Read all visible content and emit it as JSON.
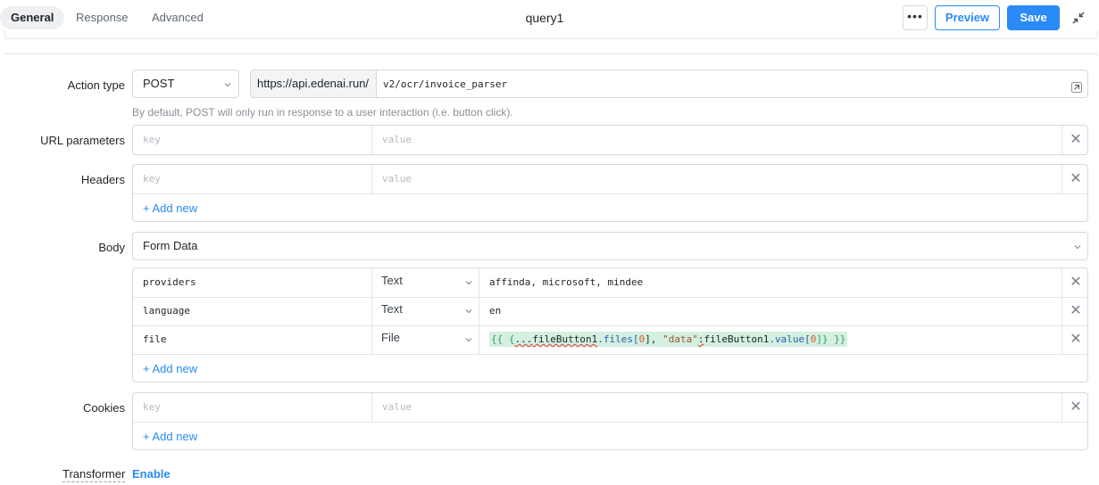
{
  "header": {
    "tabs": [
      {
        "label": "General",
        "active": true
      },
      {
        "label": "Response",
        "active": false
      },
      {
        "label": "Advanced",
        "active": false
      }
    ],
    "query_name": "query1",
    "more_label": "•••",
    "preview_label": "Preview",
    "save_label": "Save"
  },
  "action_type": {
    "label": "Action type",
    "method": "POST",
    "base_url": "https://api.edenai.run/",
    "path": "v2/ocr/invoice_parser",
    "hint": "By default, POST will only run in response to a user interaction (i.e. button click)."
  },
  "url_parameters": {
    "label": "URL parameters",
    "key_placeholder": "key",
    "value_placeholder": "value"
  },
  "headers": {
    "label": "Headers",
    "key_placeholder": "key",
    "value_placeholder": "value",
    "add_new": "+ Add new"
  },
  "body": {
    "label": "Body",
    "type": "Form Data",
    "rows": [
      {
        "key": "providers",
        "type": "Text",
        "value": "affinda, microsoft, mindee"
      },
      {
        "key": "language",
        "type": "Text",
        "value": "en"
      },
      {
        "key": "file",
        "type": "File",
        "value": "{{ {...fileButton1.files[0], \"data\":fileButton1.value[0]} }}"
      }
    ],
    "file_value_parts": {
      "open": "{{ {",
      "spread": "...",
      "ident1": "fileButton1",
      "prop1": ".files[",
      "idx1": "0",
      "close1": "], ",
      "str": "\"data\"",
      "colon": ":",
      "ident2": "fileButton1",
      "prop2": ".value[",
      "idx2": "0",
      "close2": "]} }}"
    },
    "add_new": "+ Add new"
  },
  "cookies": {
    "label": "Cookies",
    "key_placeholder": "key",
    "value_placeholder": "value",
    "add_new": "+ Add new"
  },
  "transformer": {
    "label": "Transformer",
    "action": "Enable"
  },
  "colors": {
    "accent": "#2a8af6",
    "border": "#d6d9dd",
    "code_highlight": "#d3f0e0"
  }
}
